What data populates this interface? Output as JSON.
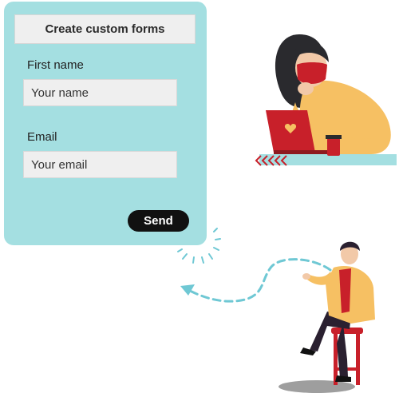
{
  "form": {
    "title": "Create custom forms",
    "first_name_label": "First name",
    "first_name_placeholder": "Your name",
    "email_label": "Email",
    "email_placeholder": "Your email",
    "send_label": "Send"
  },
  "colors": {
    "card_bg": "#a4dfe1",
    "button_bg": "#111111",
    "dashed_line": "#6fc8d4",
    "accent_red": "#c8202a",
    "sweater_yellow": "#f6c063"
  }
}
